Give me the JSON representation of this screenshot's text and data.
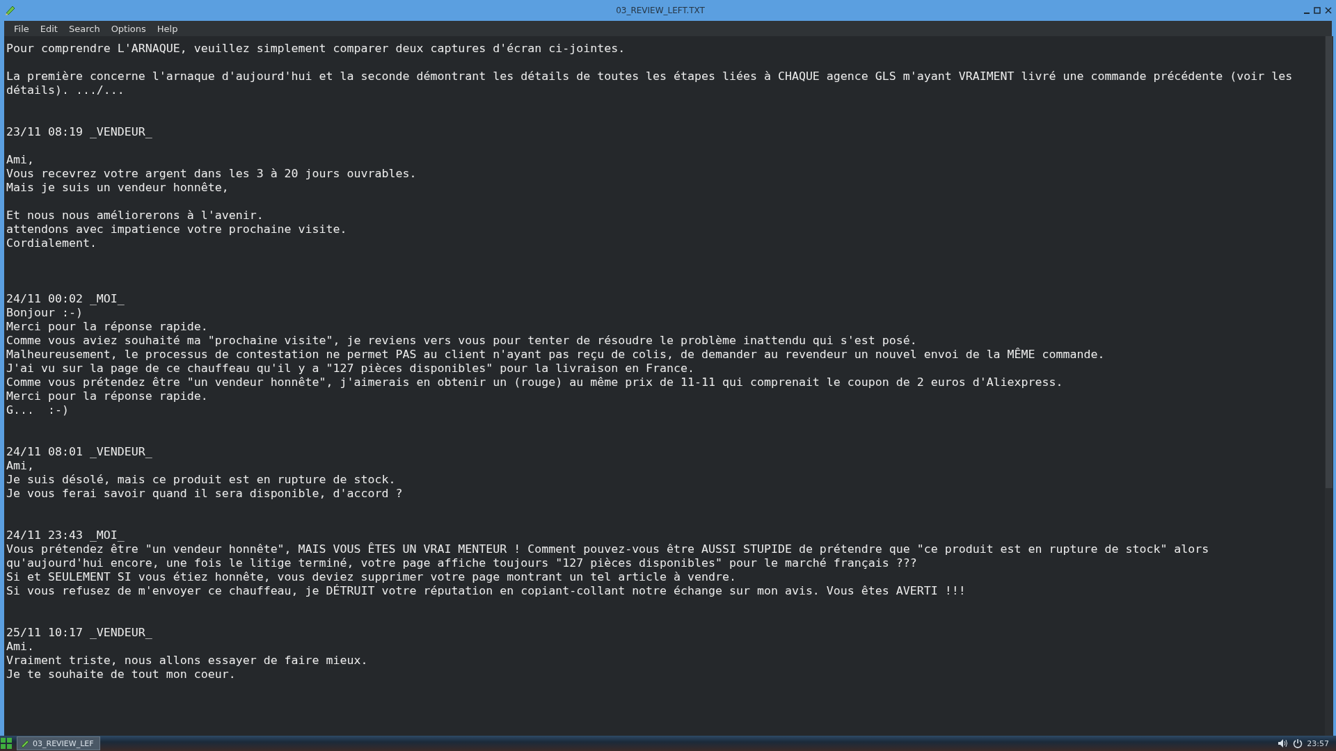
{
  "window": {
    "title": "03_REVIEW_LEFT.TXT"
  },
  "menu": [
    "File",
    "Edit",
    "Search",
    "Options",
    "Help"
  ],
  "document": {
    "text": "Pour comprendre L'ARNAQUE, veuillez simplement comparer deux captures d'écran ci-jointes.\n\nLa première concerne l'arnaque d'aujourd'hui et la seconde démontrant les détails de toutes les étapes liées à CHAQUE agence GLS m'ayant VRAIMENT livré une commande précédente (voir les\ndétails). .../...\n\n\n23/11 08:19 _VENDEUR_\n\nAmi,\nVous recevrez votre argent dans les 3 à 20 jours ouvrables.\nMais je suis un vendeur honnête,\n\nEt nous nous améliorerons à l'avenir.\nattendons avec impatience votre prochaine visite.\nCordialement.\n\n\n\n24/11 00:02 _MOI_\nBonjour :-)\nMerci pour la réponse rapide.\nComme vous aviez souhaité ma \"prochaine visite\", je reviens vers vous pour tenter de résoudre le problème inattendu qui s'est posé.\nMalheureusement, le processus de contestation ne permet PAS au client n'ayant pas reçu de colis, de demander au revendeur un nouvel envoi de la MÊME commande.\nJ'ai vu sur la page de ce chauffeau qu'il y a \"127 pièces disponibles\" pour la livraison en France.\nComme vous prétendez être \"un vendeur honnête\", j'aimerais en obtenir un (rouge) au même prix de 11-11 qui comprenait le coupon de 2 euros d'Aliexpress.\nMerci pour la réponse rapide.\nG...  :-)\n\n\n24/11 08:01 _VENDEUR_\nAmi,\nJe suis désolé, mais ce produit est en rupture de stock.\nJe vous ferai savoir quand il sera disponible, d'accord ?\n\n\n24/11 23:43 _MOI_\nVous prétendez être \"un vendeur honnête\", MAIS VOUS ÊTES UN VRAI MENTEUR ! Comment pouvez-vous être AUSSI STUPIDE de prétendre que \"ce produit est en rupture de stock\" alors\nqu'aujourd'hui encore, une fois le litige terminé, votre page affiche toujours \"127 pièces disponibles\" pour le marché français ???\nSi et SEULEMENT SI vous étiez honnête, vous deviez supprimer votre page montrant un tel article à vendre.\nSi vous refusez de m'envoyer ce chauffeau, je DÉTRUIT votre réputation en copiant-collant notre échange sur mon avis. Vous êtes AVERTI !!!\n\n\n25/11 10:17 _VENDEUR_\nAmi.\nVraiment triste, nous allons essayer de faire mieux.\nJe te souhaite de tout mon coeur."
  },
  "taskbar": {
    "tasks": [
      {
        "label": "03_REVIEW_LEF",
        "selected": true
      }
    ],
    "clock": "23:57"
  }
}
